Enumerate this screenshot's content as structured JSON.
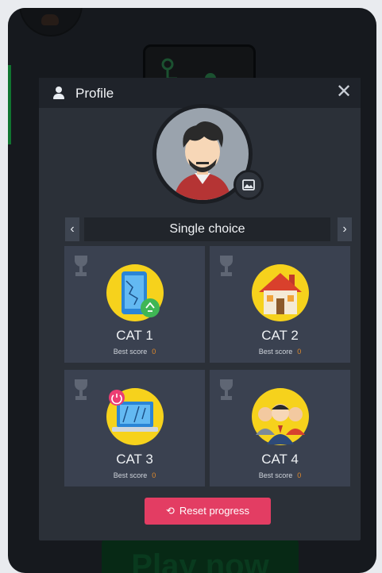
{
  "modal": {
    "title": "Profile",
    "close_icon_glyph": "✕"
  },
  "mode_selector": {
    "prev_glyph": "‹",
    "next_glyph": "›",
    "current": "Single choice"
  },
  "categories": [
    {
      "name": "CAT 1",
      "score_label": "Best score",
      "score": "0"
    },
    {
      "name": "CAT 2",
      "score_label": "Best score",
      "score": "0"
    },
    {
      "name": "CAT 3",
      "score_label": "Best score",
      "score": "0"
    },
    {
      "name": "CAT 4",
      "score_label": "Best score",
      "score": "0"
    }
  ],
  "reset_button": {
    "icon_glyph": "⟲",
    "label": "Reset progress"
  },
  "background": {
    "play_button": "Play now"
  },
  "colors": {
    "accent_reset": "#e33d63",
    "score_value": "#e08a2b",
    "card_bg": "#3a4150",
    "modal_bg": "#2b3038"
  },
  "icons": {
    "header": "user-icon",
    "avatar_edit": "image-icon",
    "trophy": "trophy-icon"
  }
}
